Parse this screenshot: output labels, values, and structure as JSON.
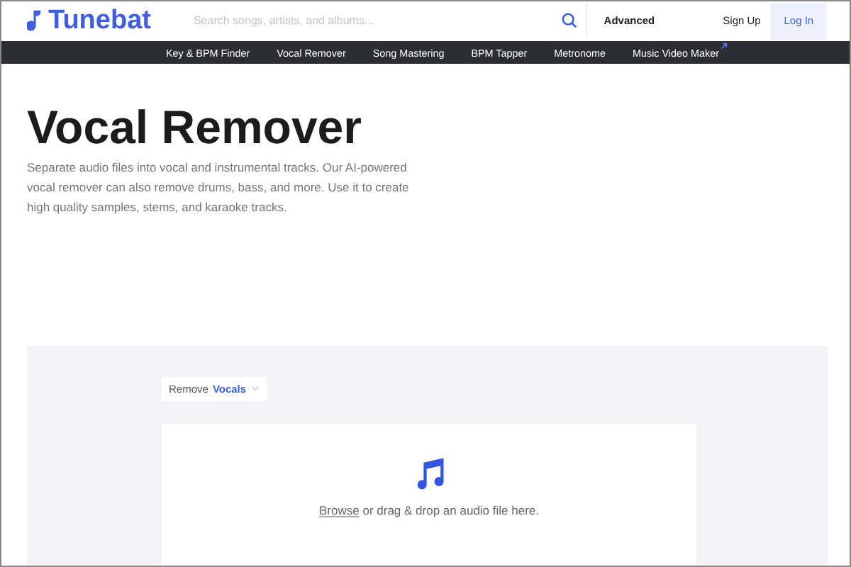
{
  "header": {
    "logo": "Tunebat",
    "search": {
      "placeholder": "Search songs, artists, and albums..."
    },
    "links": [
      "Advanced",
      "Sign Up"
    ],
    "login_button": "Log In"
  },
  "nav": [
    {
      "label": "Key & BPM Finder",
      "external": false
    },
    {
      "label": "Vocal Remover",
      "external": false
    },
    {
      "label": "Song Mastering",
      "external": false
    },
    {
      "label": "BPM Tapper",
      "external": false
    },
    {
      "label": "Metronome",
      "external": false
    },
    {
      "label": "Music Video Maker",
      "external": true
    }
  ],
  "hero": {
    "title": "Vocal Remover",
    "description": "Separate audio files into vocal and instrumental tracks. Our AI-powered vocal remover can also remove drums, bass, and more. Use it to create high quality samples, stems, and karaoke tracks."
  },
  "tool": {
    "mode": {
      "prefix": "Remove",
      "value": "Vocals"
    },
    "dropzone": {
      "link": "Browse",
      "text": "or drag & drop an audio file here."
    }
  }
}
